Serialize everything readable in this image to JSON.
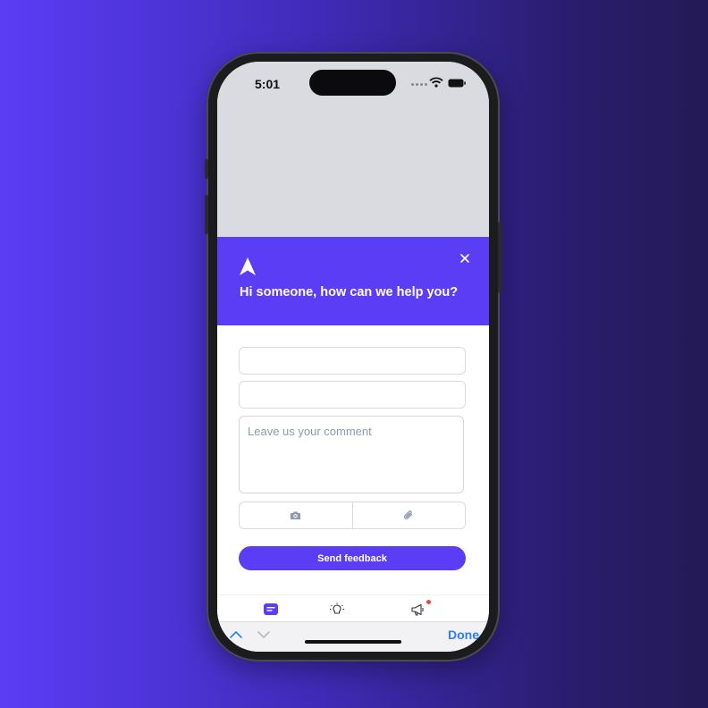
{
  "status_bar": {
    "time": "5:01"
  },
  "widget": {
    "greeting": "Hi someone, how can we help you?",
    "comment_placeholder": "Leave us your comment",
    "send_label": "Send feedback"
  },
  "keyboard_toolbar": {
    "done_label": "Done"
  },
  "icons": {
    "logo": "arrow-up-logo",
    "close": "close-icon",
    "camera": "camera-icon",
    "attachment": "paperclip-icon",
    "tab_feedback": "message-icon",
    "tab_ideas": "lightbulb-icon",
    "tab_news": "megaphone-icon"
  },
  "colors": {
    "accent": "#5b3df5",
    "notification_dot": "#f0453a",
    "done_link": "#2f7cf6"
  }
}
